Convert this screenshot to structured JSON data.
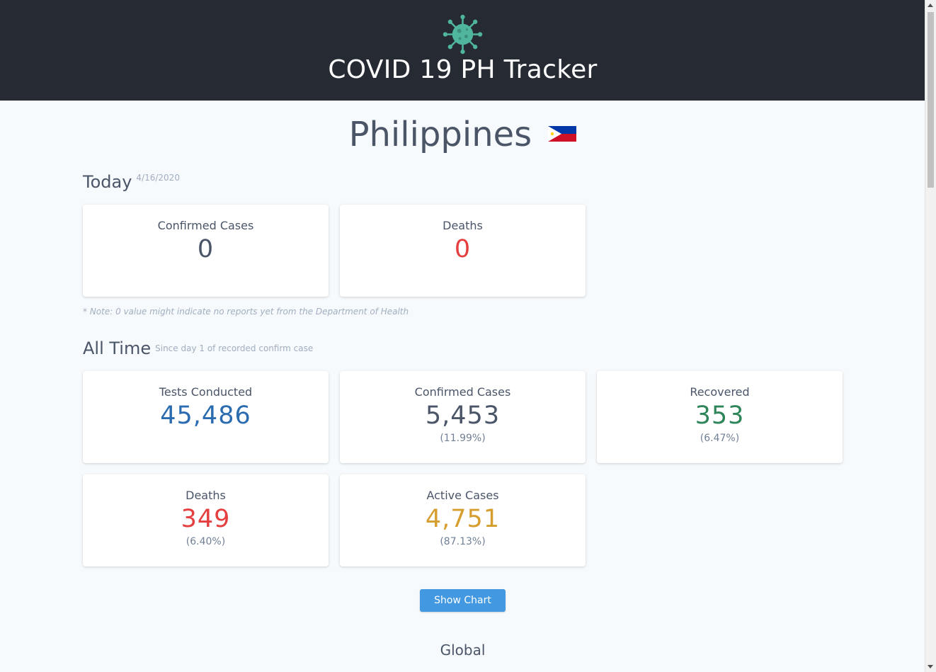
{
  "app": {
    "title": "COVID 19 PH Tracker",
    "logo_icon": "virus-icon"
  },
  "country": {
    "name": "Philippines",
    "flag_icon": "philippines-flag-icon"
  },
  "today": {
    "title": "Today",
    "date": "4/16/2020",
    "cards": [
      {
        "label": "Confirmed Cases",
        "value": "0",
        "color": "#4a5568"
      },
      {
        "label": "Deaths",
        "value": "0",
        "color": "#e53e3e"
      }
    ],
    "note": "* Note: 0 value might indicate no reports yet from the Department of Health"
  },
  "all_time": {
    "title": "All Time",
    "subtitle": "Since day 1 of recorded confirm case",
    "cards": [
      {
        "label": "Tests Conducted",
        "value": "45,486",
        "percent": "",
        "color": "#2b6cb0"
      },
      {
        "label": "Confirmed Cases",
        "value": "5,453",
        "percent": "(11.99%)",
        "color": "#4a5568"
      },
      {
        "label": "Recovered",
        "value": "353",
        "percent": "(6.47%)",
        "color": "#2f855a"
      },
      {
        "label": "Deaths",
        "value": "349",
        "percent": "(6.40%)",
        "color": "#e53e3e"
      },
      {
        "label": "Active Cases",
        "value": "4,751",
        "percent": "(87.13%)",
        "color": "#d69e2e"
      }
    ]
  },
  "show_chart_label": "Show Chart",
  "global_title": "Global",
  "colors": {
    "header_bg": "#252a33",
    "page_bg": "#f7fafc",
    "button": "#4299e1",
    "logo": "#4fb59b"
  }
}
